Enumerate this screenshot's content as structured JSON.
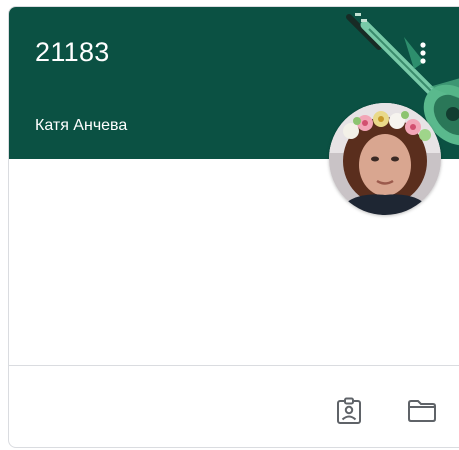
{
  "class_card": {
    "title": "21183",
    "teacher_name": "Катя Анчева",
    "header_color": "#0b5143",
    "header_theme_icon": "guitar-icon",
    "menu_icon": "more-vert-icon",
    "avatar_icon": "teacher-avatar",
    "footer_actions": [
      {
        "icon": "assignment-ind-icon"
      },
      {
        "icon": "folder-icon"
      }
    ]
  }
}
